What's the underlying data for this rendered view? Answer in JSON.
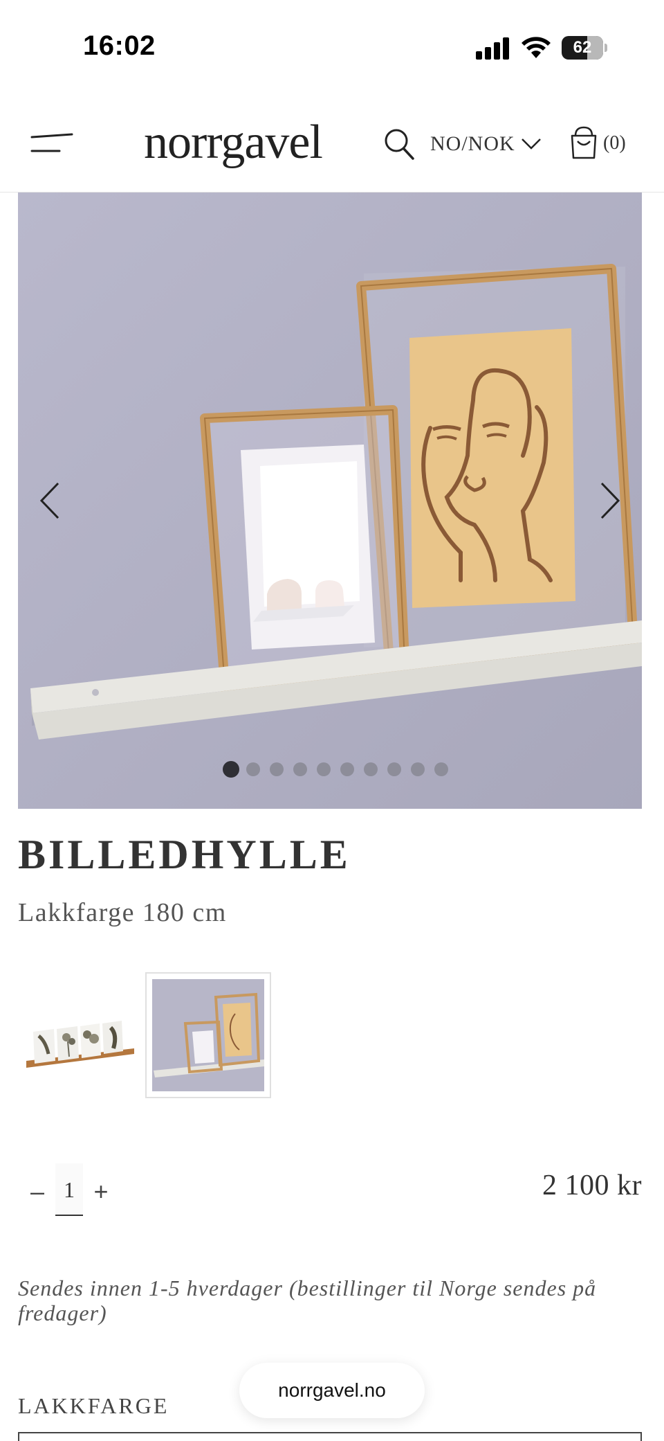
{
  "status_bar": {
    "time": "16:02",
    "battery": "62",
    "battery_level": 0.62
  },
  "header": {
    "logo": "norrgavel",
    "currency": "NO/NOK",
    "cart_count": "(0)",
    "icons": [
      "menu-icon",
      "search-icon",
      "chevron-down-icon",
      "shopping-bag-icon"
    ]
  },
  "gallery": {
    "image_count": 10,
    "active_index": 0,
    "prev_icon": "chevron-left-icon",
    "next_icon": "chevron-right-icon"
  },
  "product": {
    "title": "BILLEDHYLLE",
    "variant": "Lakkfarge 180 cm",
    "quantity": "1",
    "minus": "–",
    "plus": "+",
    "price": "2 100 kr",
    "shipping": "Sendes innen 1-5 hverdager (bestillinger til Norge sendes på fredager)",
    "color_label": "LAKKFARGE"
  },
  "browser": {
    "url": "norrgavel.no"
  },
  "colors": {
    "gallery_bg": "#b3b3c6",
    "frame_wood": "#c89a62",
    "shelf": "#e4e3de"
  }
}
